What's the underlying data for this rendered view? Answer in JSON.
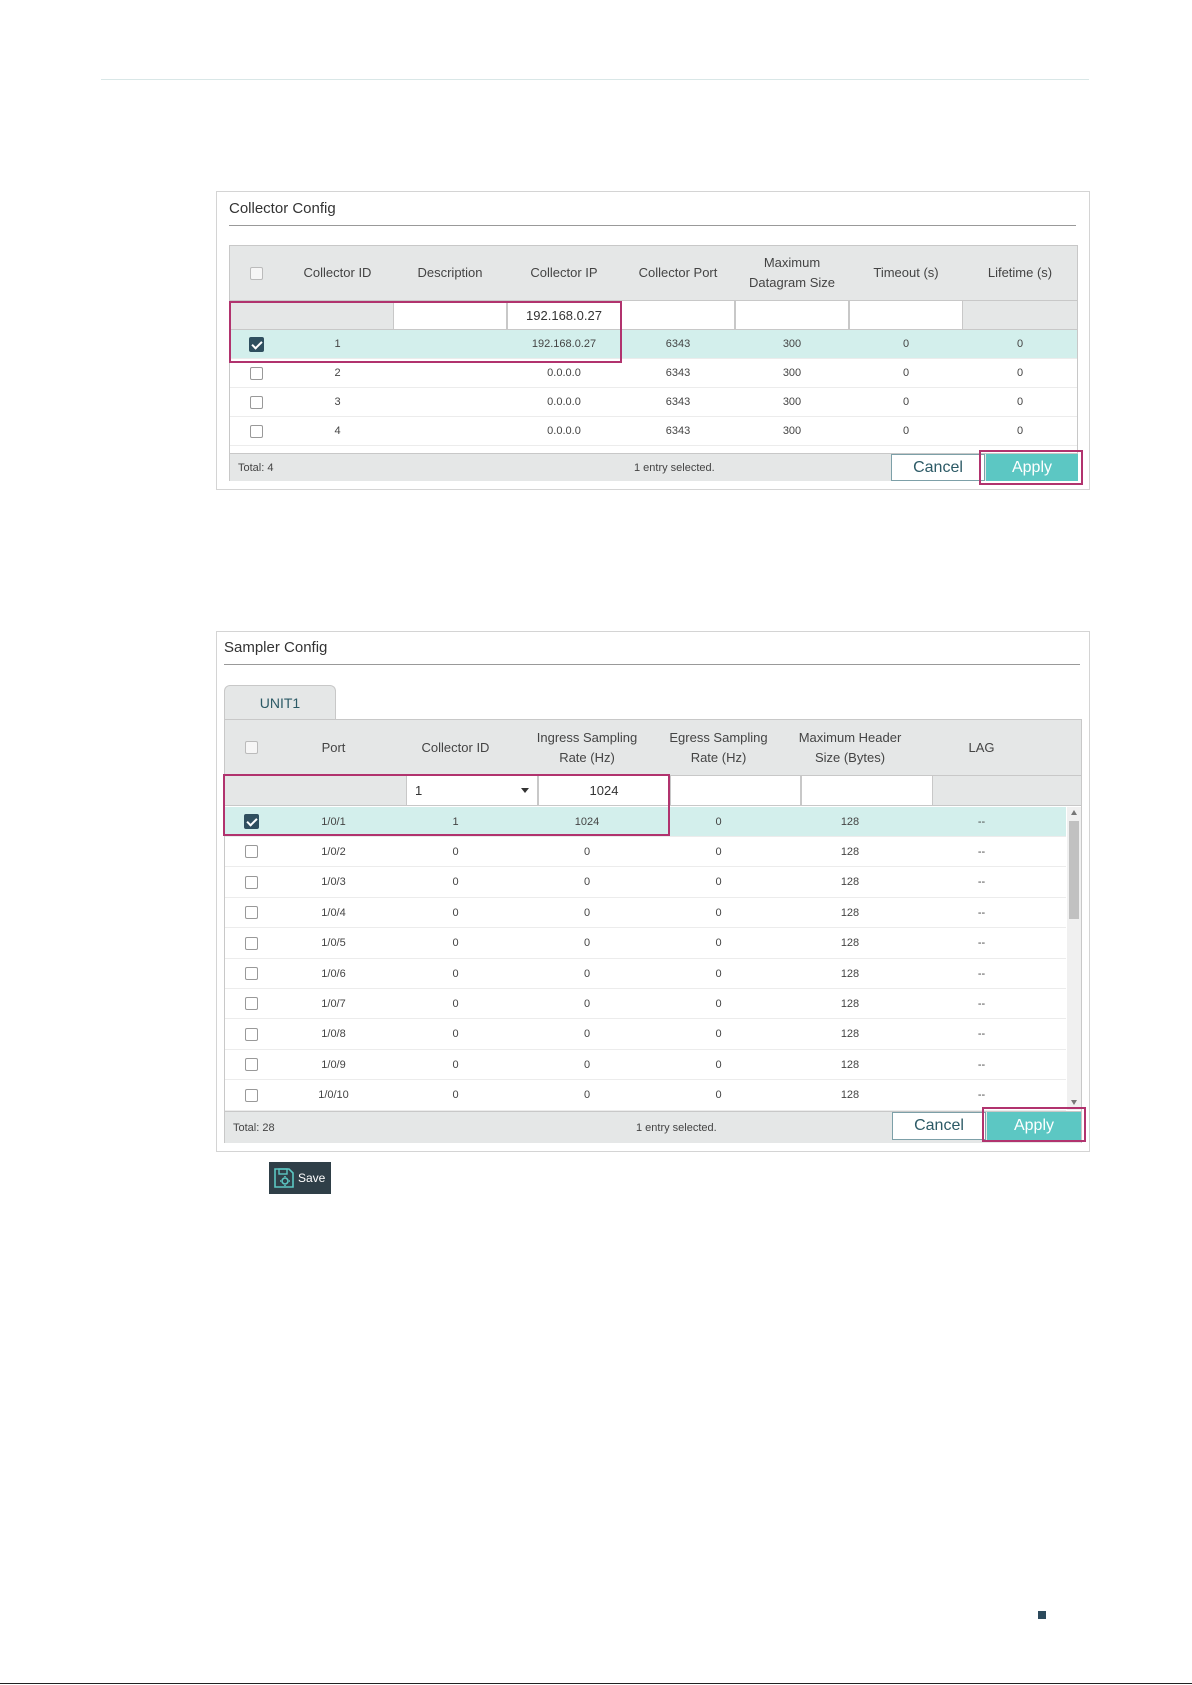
{
  "collector": {
    "title": "Collector Config",
    "headers": [
      "Collector ID",
      "Description",
      "Collector IP",
      "Collector Port",
      "Maximum Datagram Size",
      "Timeout (s)",
      "Lifetime (s)"
    ],
    "edit_ip_value": "192.168.0.27",
    "rows": [
      {
        "id": "1",
        "ip": "192.168.0.27",
        "port": "6343",
        "size": "300",
        "timeout": "0",
        "lifetime": "0",
        "checked": true
      },
      {
        "id": "2",
        "ip": "0.0.0.0",
        "port": "6343",
        "size": "300",
        "timeout": "0",
        "lifetime": "0",
        "checked": false
      },
      {
        "id": "3",
        "ip": "0.0.0.0",
        "port": "6343",
        "size": "300",
        "timeout": "0",
        "lifetime": "0",
        "checked": false
      },
      {
        "id": "4",
        "ip": "0.0.0.0",
        "port": "6343",
        "size": "300",
        "timeout": "0",
        "lifetime": "0",
        "checked": false
      }
    ],
    "total": "Total: 4",
    "selected": "1 entry selected.",
    "cancel": "Cancel",
    "apply": "Apply"
  },
  "sampler": {
    "title": "Sampler Config",
    "tab": "UNIT1",
    "headers": [
      "Port",
      "Collector ID",
      "Ingress Sampling Rate (Hz)",
      "Egress Sampling Rate (Hz)",
      "Maximum Header Size (Bytes)",
      "LAG"
    ],
    "edit_collector_value": "1",
    "edit_ingress_value": "1024",
    "rows": [
      {
        "port": "1/0/1",
        "collector": "1",
        "ingress": "1024",
        "egress": "0",
        "header": "128",
        "lag": "--",
        "checked": true
      },
      {
        "port": "1/0/2",
        "collector": "0",
        "ingress": "0",
        "egress": "0",
        "header": "128",
        "lag": "--",
        "checked": false
      },
      {
        "port": "1/0/3",
        "collector": "0",
        "ingress": "0",
        "egress": "0",
        "header": "128",
        "lag": "--",
        "checked": false
      },
      {
        "port": "1/0/4",
        "collector": "0",
        "ingress": "0",
        "egress": "0",
        "header": "128",
        "lag": "--",
        "checked": false
      },
      {
        "port": "1/0/5",
        "collector": "0",
        "ingress": "0",
        "egress": "0",
        "header": "128",
        "lag": "--",
        "checked": false
      },
      {
        "port": "1/0/6",
        "collector": "0",
        "ingress": "0",
        "egress": "0",
        "header": "128",
        "lag": "--",
        "checked": false
      },
      {
        "port": "1/0/7",
        "collector": "0",
        "ingress": "0",
        "egress": "0",
        "header": "128",
        "lag": "--",
        "checked": false
      },
      {
        "port": "1/0/8",
        "collector": "0",
        "ingress": "0",
        "egress": "0",
        "header": "128",
        "lag": "--",
        "checked": false
      },
      {
        "port": "1/0/9",
        "collector": "0",
        "ingress": "0",
        "egress": "0",
        "header": "128",
        "lag": "--",
        "checked": false
      },
      {
        "port": "1/0/10",
        "collector": "0",
        "ingress": "0",
        "egress": "0",
        "header": "128",
        "lag": "--",
        "checked": false
      }
    ],
    "total": "Total: 28",
    "selected": "1 entry selected.",
    "cancel": "Cancel",
    "apply": "Apply"
  },
  "save_label": "Save",
  "colors": {
    "accent": "#5cc7c3",
    "highlight": "#b1336e",
    "selected_row": "#d3efec",
    "dark": "#2f3f48"
  }
}
